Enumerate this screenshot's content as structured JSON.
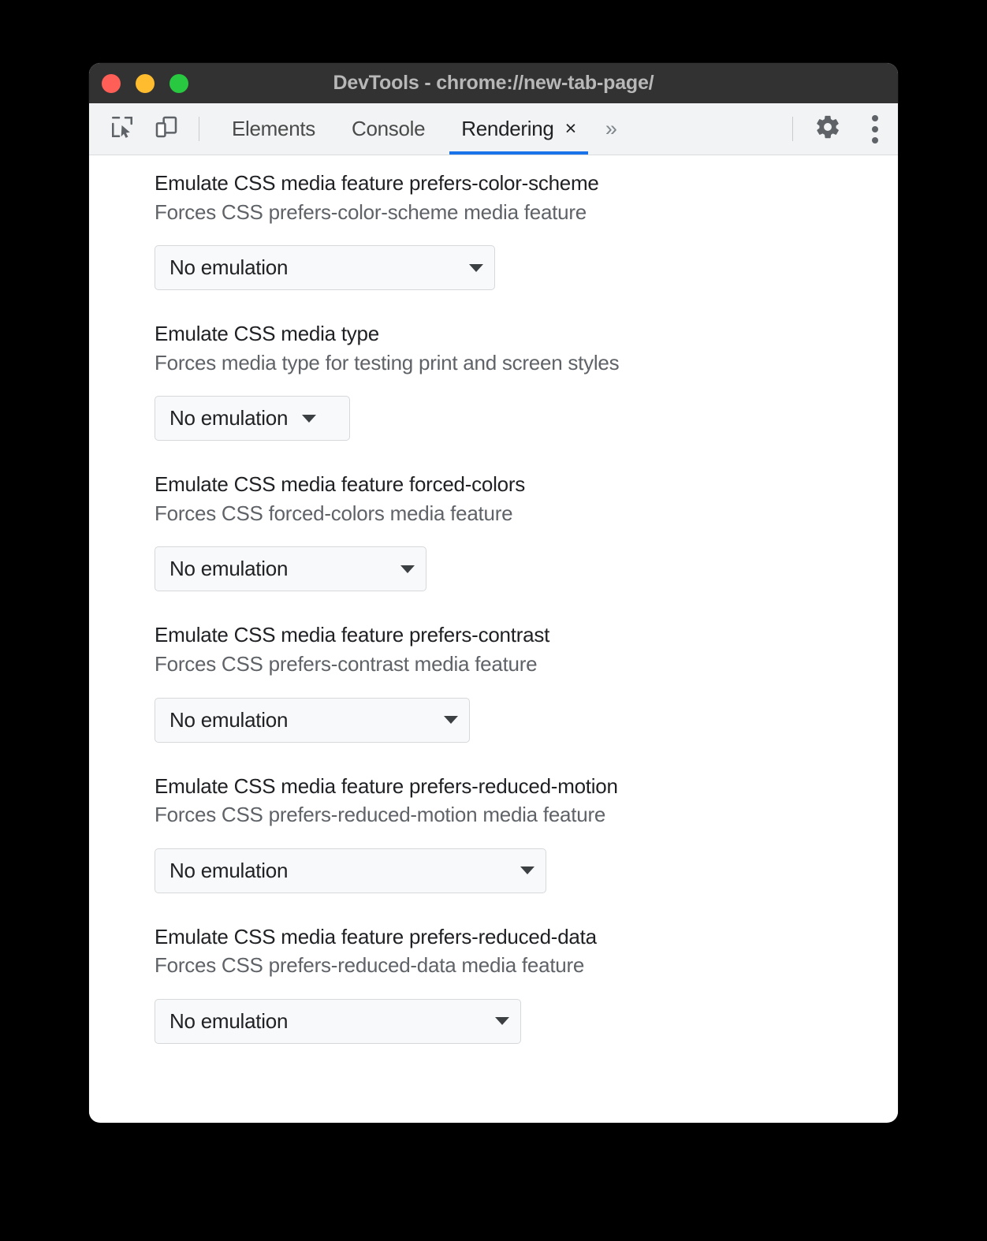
{
  "window": {
    "title": "DevTools - chrome://new-tab-page/",
    "traffic_lights": [
      {
        "name": "close",
        "color": "#ff5f57"
      },
      {
        "name": "minimize",
        "color": "#febc2e"
      },
      {
        "name": "zoom",
        "color": "#28c840"
      }
    ]
  },
  "toolbar": {
    "inspect_icon": "inspect-element-icon",
    "device_icon": "device-toolbar-icon",
    "overflow_label": "»",
    "settings_icon": "gear-icon",
    "more_icon": "more-vertical-icon",
    "active_accent": "#1a73e8",
    "tabs": [
      {
        "label": "Elements",
        "active": false,
        "closable": false
      },
      {
        "label": "Console",
        "active": false,
        "closable": false
      },
      {
        "label": "Rendering",
        "active": true,
        "closable": true,
        "close_label": "×"
      }
    ]
  },
  "panel": {
    "settings": [
      {
        "title": "Emulate CSS media feature prefers-color-scheme",
        "description": "Forces CSS prefers-color-scheme media feature",
        "value": "No emulation"
      },
      {
        "title": "Emulate CSS media type",
        "description": "Forces media type for testing print and screen styles",
        "value": "No emulation"
      },
      {
        "title": "Emulate CSS media feature forced-colors",
        "description": "Forces CSS forced-colors media feature",
        "value": "No emulation"
      },
      {
        "title": "Emulate CSS media feature prefers-contrast",
        "description": "Forces CSS prefers-contrast media feature",
        "value": "No emulation"
      },
      {
        "title": "Emulate CSS media feature prefers-reduced-motion",
        "description": "Forces CSS prefers-reduced-motion media feature",
        "value": "No emulation"
      },
      {
        "title": "Emulate CSS media feature prefers-reduced-data",
        "description": "Forces CSS prefers-reduced-data media feature",
        "value": "No emulation"
      }
    ]
  }
}
